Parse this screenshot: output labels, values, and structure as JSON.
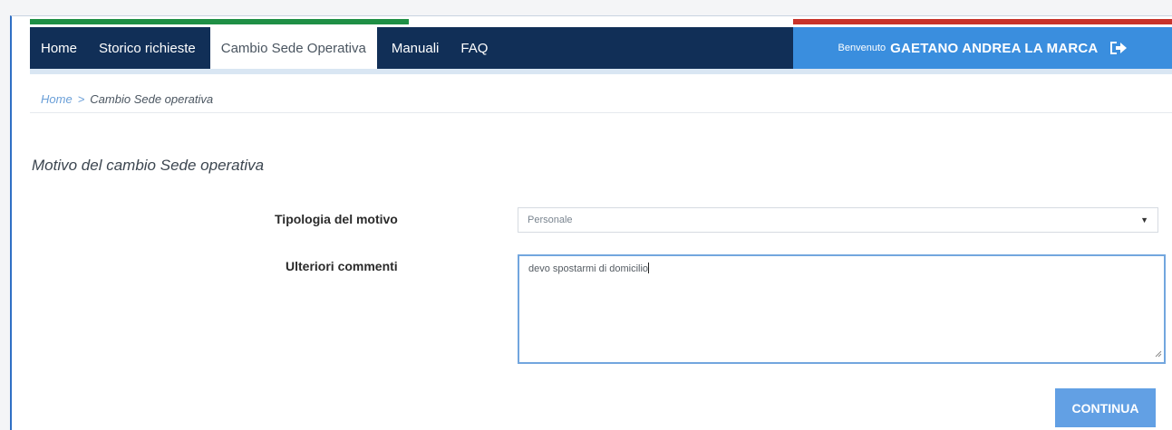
{
  "nav": {
    "items": [
      {
        "label": "Home"
      },
      {
        "label": "Storico richieste"
      },
      {
        "label": "Cambio Sede Operativa",
        "active": true
      },
      {
        "label": "Manuali"
      },
      {
        "label": "FAQ"
      }
    ],
    "welcome_prefix": "Benvenuto",
    "user_name": "GAETANO ANDREA LA MARCA",
    "logout_icon": "logout-icon"
  },
  "breadcrumb": {
    "home": "Home",
    "separator": ">",
    "current": "Cambio Sede operativa"
  },
  "form": {
    "section_title": "Motivo del cambio Sede operativa",
    "tipologia_label": "Tipologia del motivo",
    "tipologia_value": "Personale",
    "commenti_label": "Ulteriori commenti",
    "commenti_value": "devo spostarmi di domicilio",
    "submit_label": "CONTINUA"
  },
  "colors": {
    "navbar": "#112f57",
    "welcome_bar": "#3a8ede",
    "button": "#62a0e4",
    "flag_green": "#1f8f45",
    "flag_red": "#c8332a"
  }
}
